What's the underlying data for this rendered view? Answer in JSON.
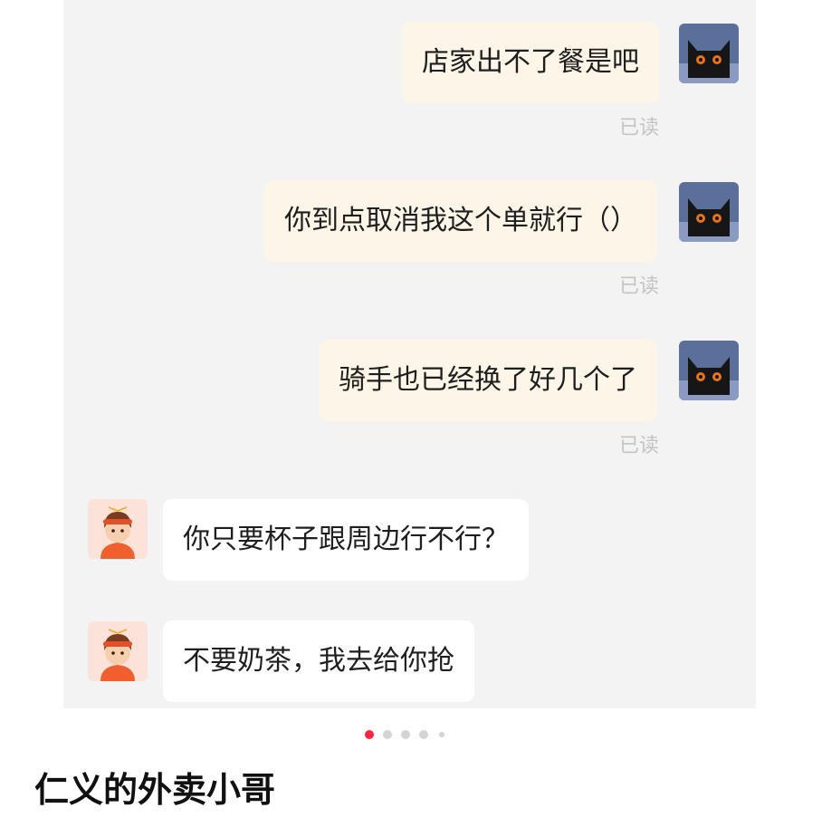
{
  "messages": [
    {
      "side": "right",
      "text": "店家出不了餐是吧",
      "status": "已读"
    },
    {
      "side": "right",
      "text": "你到点取消我这个单就行（）",
      "status": "已读"
    },
    {
      "side": "right",
      "text": "骑手也已经换了好几个了",
      "status": "已读"
    },
    {
      "side": "left",
      "text": "你只要杯子跟周边行不行？"
    },
    {
      "side": "left",
      "text": "不要奶茶，我去给你抢"
    }
  ],
  "avatars": {
    "self": "black-cat-avatar-icon",
    "other": "delivery-boy-avatar-icon"
  },
  "pager": {
    "total": 5,
    "active": 1
  },
  "post": {
    "title": "仁义的外卖小哥"
  },
  "colors": {
    "accent": "#ff2442",
    "bubble_self": "#fdf6e8",
    "bubble_other": "#ffffff",
    "panel": "#f3f3f4"
  }
}
